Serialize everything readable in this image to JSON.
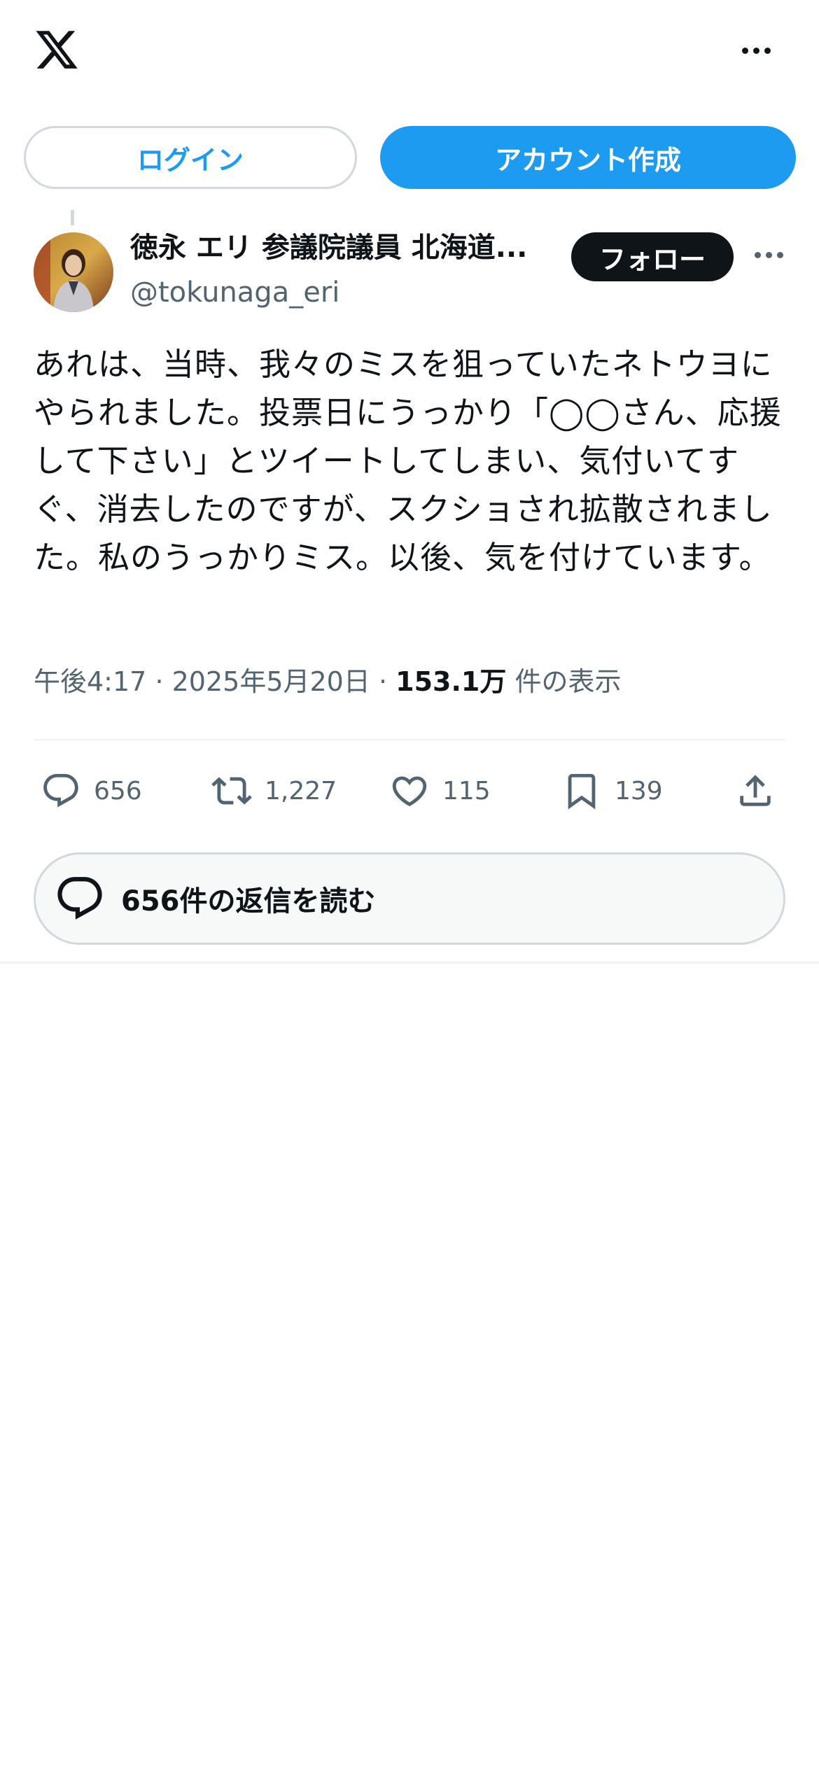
{
  "header": {
    "logo_icon": "x-logo-icon",
    "more_icon": "more-horizontal-icon"
  },
  "auth": {
    "login_label": "ログイン",
    "signup_label": "アカウント作成"
  },
  "post": {
    "author_name": "徳永 エリ 参議院議員 北海道...",
    "author_handle": "@tokunaga_eri",
    "follow_label": "フォロー",
    "text": "あれは、当時、我々のミスを狙っていたネトウヨにやられました。投票日にうっかり「◯◯さん、応援して下さい」とツイートしてしまい、気付いてすぐ、消去したのですが、スクショされ拡散されました。私のうっかりミス。以後、気を付けています。",
    "time": "午後4:17",
    "separator": "·",
    "date": "2025年5月20日",
    "views_count": "153.1万",
    "views_label": "件の表示"
  },
  "actions": {
    "replies": "656",
    "reposts": "1,227",
    "likes": "115",
    "bookmarks": "139"
  },
  "read_replies_label": "656件の返信を読む",
  "colors": {
    "accent": "#1d9bf0",
    "text": "#0f1419",
    "secondary": "#536471",
    "border": "#cfd9de"
  }
}
